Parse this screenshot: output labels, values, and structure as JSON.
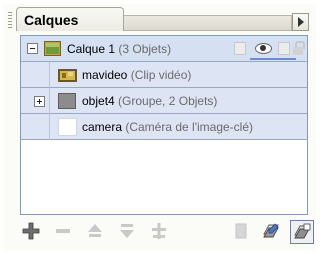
{
  "panel": {
    "tab_title": "Calques"
  },
  "layers": [
    {
      "name": "Calque 1",
      "detail": " (3 Objets)"
    },
    {
      "name": "mavideo",
      "detail": " (Clip vidéo)"
    },
    {
      "name": "objet4",
      "detail": " (Groupe, 2 Objets)"
    },
    {
      "name": "camera",
      "detail": " (Caméra de l'image-clé)"
    }
  ],
  "colors": {
    "selected_row": "#d6e0f3",
    "child_row": "#dde5f5",
    "list_border": "#7f9db9",
    "muted_text": "#6a6a6a"
  },
  "icons": {
    "toolbar": [
      "add-layer-icon",
      "delete-icon",
      "move-up-icon",
      "move-down-icon",
      "anchor-icon",
      "page-icon",
      "layer-options-icon",
      "layer-settings-icon"
    ]
  }
}
